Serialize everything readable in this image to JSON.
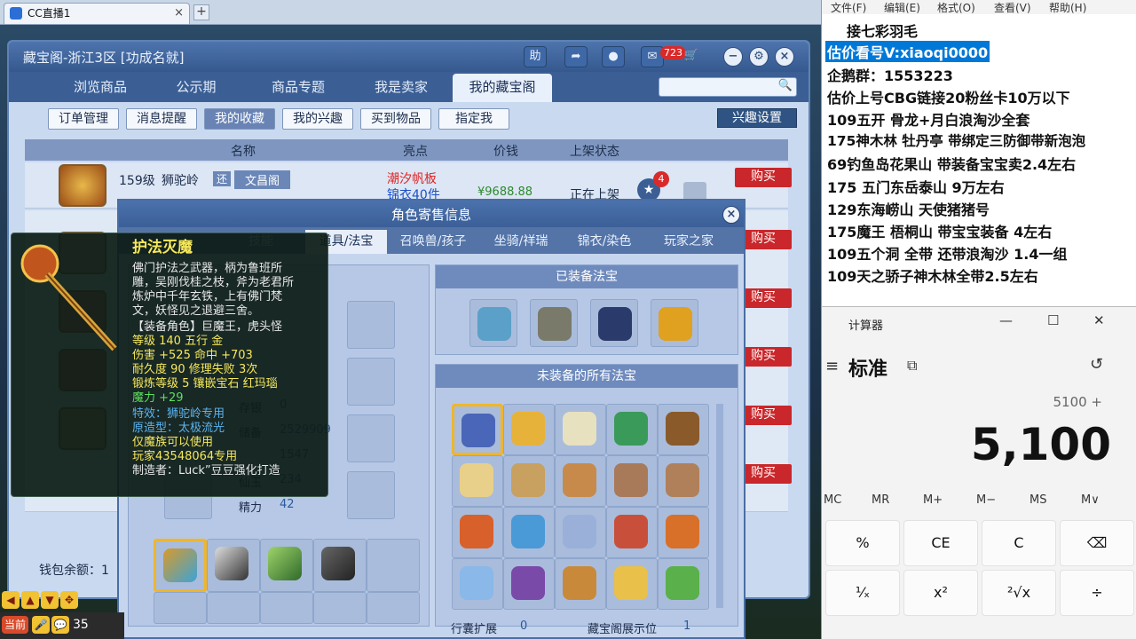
{
  "browser": {
    "tab_title": "CC直播1",
    "tab_close": "×",
    "new_tab": "+"
  },
  "main_window": {
    "title": "藏宝阁-浙江3区 [功成名就]",
    "title_buttons": {
      "help": "助",
      "notice_badge": "723"
    },
    "tabs": [
      "浏览商品",
      "公示期",
      "商品专题",
      "我是卖家",
      "我的藏宝阁"
    ],
    "subtabs": [
      "订单管理",
      "消息提醒",
      "我的收藏",
      "我的兴趣",
      "买到物品",
      "指定我"
    ],
    "interest_button": "兴趣设置",
    "columns": [
      "名称",
      "亮点",
      "价钱",
      "上架状态"
    ],
    "first_row": {
      "level": "159级",
      "school": "狮驼岭",
      "tag": "还",
      "server": "文昌阁",
      "highlight1": "潮汐帆板",
      "highlight2": "锦衣40件",
      "price": "¥9688.88",
      "status": "正在上架",
      "fav_count": "4"
    },
    "buy_label": "购买",
    "wallet_label": "钱包余额：1"
  },
  "dialog": {
    "title": "角色寄售信息",
    "close": "×",
    "left_tab": "技能",
    "tabs": [
      "道具/法宝",
      "召唤兽/孩子",
      "坐骑/祥瑞",
      "锦衣/染色",
      "玩家之家"
    ],
    "equipped_header": "已装备法宝",
    "unequipped_header": "未装备的所有法宝",
    "stats": [
      {
        "label": "存银",
        "value": "0"
      },
      {
        "label": "储备",
        "value": "2529909"
      },
      {
        "label": "",
        "value": "1547"
      },
      {
        "label": "仙玉",
        "value": "234"
      },
      {
        "label": "精力",
        "value": "42"
      }
    ],
    "bag_expand_label": "行囊扩展",
    "bag_expand_value": "0",
    "display_slot_label": "藏宝阁展示位",
    "display_slot_value": "1"
  },
  "tooltip": {
    "name": "护法灭魔",
    "desc": [
      "佛门护法之武器，柄为鲁班所",
      "雕，吴刚伐桂之枝，斧为老君所",
      "炼炉中千年玄铁，上有佛门梵",
      "文，妖怪见之退避三舍。"
    ],
    "role": "【装备角色】巨魔王，虎头怪",
    "level": "等级 140   五行 金",
    "damage": "伤害 +525  命中 +703",
    "durability": "耐久度 90   修理失败 3次",
    "forge": "锻炼等级 5   镶嵌宝石 红玛瑙",
    "magic": "魔力 +29",
    "effect": "特效：狮驼岭专用",
    "origin": "原造型：太极流光",
    "limit": "仅魔族可以使用",
    "owner": "玩家43548064专用",
    "maker": "制造者：Luck”豆豆强化打造"
  },
  "notepad": {
    "menu": [
      "文件(F)",
      "编辑(E)",
      "格式(O)",
      "查看(V)",
      "帮助(H)"
    ],
    "lines": [
      "接七彩羽毛",
      "估价看号V:xiaoqi0000",
      "企鹅群：1553223",
      "估价上号CBG链接20粉丝卡10万以下",
      "109五开 骨龙+月白浪淘沙全套",
      "175神木林 牡丹亭  带绑定三防御带新泡泡",
      "69钓鱼岛花果山 带装备宝宝卖2.4左右",
      "175 五门东岳泰山  9万左右",
      "129东海崂山 天使猪猪号",
      "175魔王 梧桐山  带宝宝装备 4左右",
      "109五个洞 全带 还带浪淘沙  1.4一组",
      "109天之骄子神木林全带2.5左右"
    ]
  },
  "calculator": {
    "title": "计算器",
    "mode": "标准",
    "expression": "5100 +",
    "display": "5,100",
    "memory": [
      "MC",
      "MR",
      "M+",
      "M−",
      "MS",
      "M∨"
    ],
    "keys": [
      "%",
      "CE",
      "C",
      "⌫",
      "¹⁄ₓ",
      "x²",
      "²√x",
      "÷"
    ]
  },
  "bottom": {
    "current": "当前",
    "num": "35"
  },
  "colors": {
    "accent": "#3b5f95",
    "buy": "#c9272b",
    "highlight": "#0078d7",
    "tooltip_yellow": "#f6e85a"
  }
}
